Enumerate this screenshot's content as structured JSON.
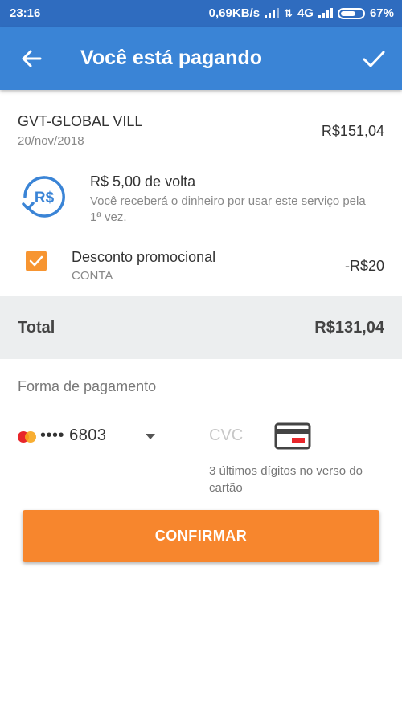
{
  "status_bar": {
    "time": "23:16",
    "network_speed": "0,69KB/s",
    "network_type": "4G",
    "battery": "67%"
  },
  "app_bar": {
    "title": "Você está pagando",
    "back_icon": "arrow-left-icon",
    "confirm_icon": "check-icon"
  },
  "bill": {
    "merchant": "GVT-GLOBAL VILL",
    "date": "20/nov/2018",
    "amount": "R$151,04"
  },
  "cashback": {
    "icon_text": "R$",
    "title": "R$ 5,00 de volta",
    "description": "Você receberá o dinheiro por usar este serviço pela 1ª vez."
  },
  "promo": {
    "checked": true,
    "title": "Desconto promocional",
    "subtitle": "CONTA",
    "value": "-R$20"
  },
  "total": {
    "label": "Total",
    "value": "R$131,04"
  },
  "payment": {
    "label": "Forma de pagamento",
    "card_number": "•••• 6803",
    "card_brand_icon": "mastercard-icon",
    "cvc_placeholder": "CVC",
    "cvc_value": "",
    "cvc_hint": "3 últimos dígitos no verso do cartão"
  },
  "confirm_button": {
    "label": "CONFIRMAR"
  },
  "colors": {
    "app_bar": "#3a84d6",
    "status_bar": "#2f6cbf",
    "accent_orange": "#f7862d",
    "cashback_blue": "#3a84d6",
    "total_bar": "#eceeef"
  }
}
